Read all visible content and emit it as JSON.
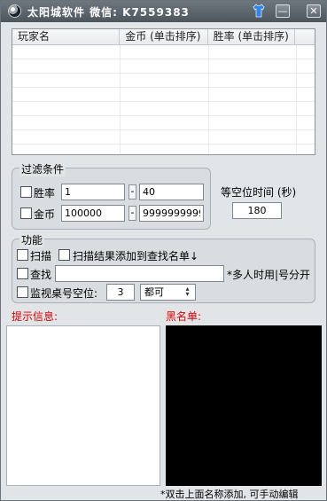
{
  "window": {
    "title": "太阳城软件  微信: K7559383",
    "minimize_label": "—",
    "close_label": "✕"
  },
  "table": {
    "columns": [
      "玩家名",
      "金币 (单击排序)",
      "胜率 (单击排序)"
    ],
    "rows": []
  },
  "filter": {
    "group_label": "过滤条件",
    "winrate_label": "胜率",
    "winrate_min": "1",
    "winrate_max": "40",
    "gold_label": "金币",
    "gold_min": "100000",
    "gold_max": "9999999999",
    "range_separator": "-"
  },
  "idle": {
    "label": "等空位时间 (秒)",
    "value": "180"
  },
  "functions": {
    "group_label": "功能",
    "scan_label": "扫描",
    "scan_add_label": "扫描结果添加到查找名单↓",
    "search_label": "查找",
    "search_value": "",
    "search_hint": "*多人时用|号分开",
    "monitor_label": "监视桌号空位:",
    "monitor_value": "3",
    "monitor_mode": "都可"
  },
  "info": {
    "tips_label": "提示信息:",
    "blacklist_label": "黑名单:",
    "footer_hint": "*双击上面名称添加, 可手动编辑"
  },
  "colors": {
    "accent_red": "#e00000",
    "titlebar": "#565e66"
  }
}
